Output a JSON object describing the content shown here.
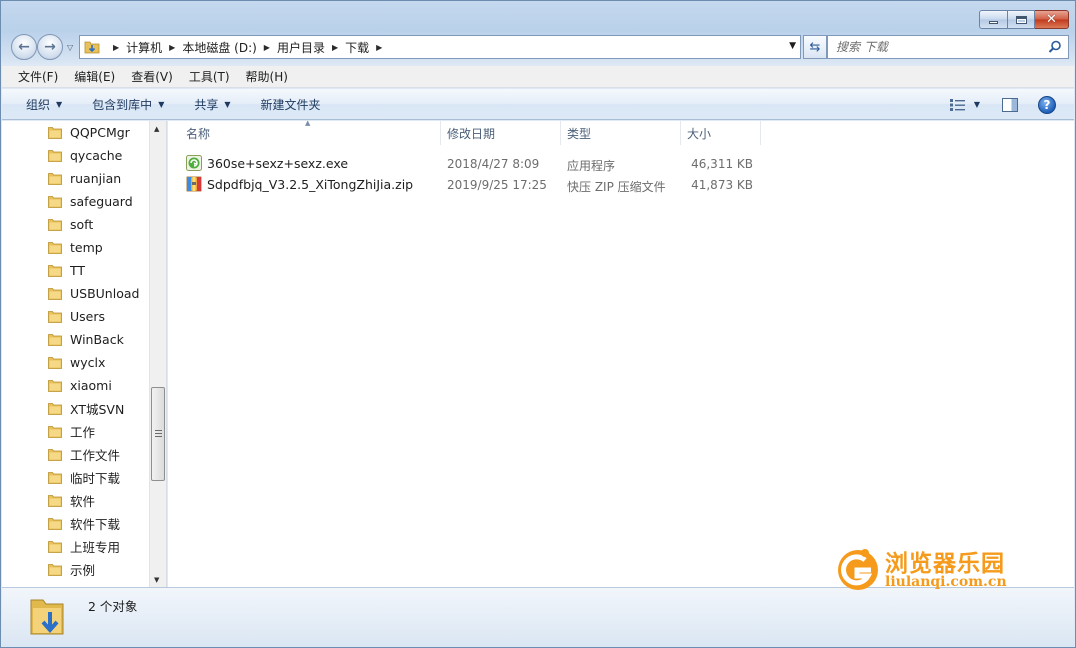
{
  "address": {
    "crumbs": [
      "计算机",
      "本地磁盘 (D:)",
      "用户目录",
      "下载"
    ]
  },
  "search": {
    "placeholder": "搜索 下载"
  },
  "menubar": {
    "items": [
      "文件(F)",
      "编辑(E)",
      "查看(V)",
      "工具(T)",
      "帮助(H)"
    ]
  },
  "toolbar": {
    "organize": "组织",
    "include_library": "包含到库中",
    "share": "共享",
    "new_folder": "新建文件夹"
  },
  "navpane": {
    "items": [
      "QQPCMgr",
      "qycache",
      "ruanjian",
      "safeguard",
      "soft",
      "temp",
      "TT",
      "USBUnload",
      "Users",
      "WinBack",
      "wyclx",
      "xiaomi",
      "XT城SVN",
      "工作",
      "工作文件",
      "临时下载",
      "软件",
      "软件下载",
      "上班专用",
      "示例"
    ]
  },
  "columns": {
    "name": "名称",
    "date": "修改日期",
    "type": "类型",
    "size": "大小"
  },
  "files": [
    {
      "name": "360se+sexz+sexz.exe",
      "date": "2018/4/27 8:09",
      "type": "应用程序",
      "size": "46,311 KB",
      "icon": "exe-icon"
    },
    {
      "name": "Sdpdfbjq_V3.2.5_XiTongZhiJia.zip",
      "date": "2019/9/25 17:25",
      "type": "快压 ZIP 压缩文件",
      "size": "41,873 KB",
      "icon": "zip-icon"
    }
  ],
  "status": {
    "text": "2 个对象"
  },
  "watermark": {
    "title": "浏览器乐园",
    "url": "liulanqi.com.cn"
  },
  "colors": {
    "accent": "#f59a1a",
    "folder": "#e8c15a",
    "frame": "#b9d1ea"
  }
}
